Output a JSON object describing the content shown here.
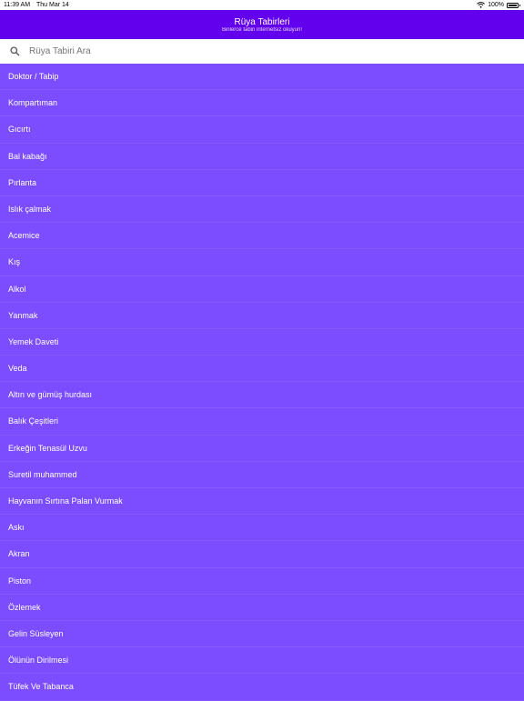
{
  "status_bar": {
    "time": "11:39 AM",
    "date": "Thu Mar 14",
    "battery": "100%"
  },
  "header": {
    "title": "Rüya Tabirleri",
    "subtitle": "Binlerce tabiri internetsiz okuyun!"
  },
  "search": {
    "placeholder": "Rüya Tabiri Ara"
  },
  "items": [
    "Doktor / Tabip",
    "Kompartıman",
    "Gıcırtı",
    "Bal kabağı",
    "Pırlanta",
    "Islık çalmak",
    "Acemice",
    "Kış",
    "Alkol",
    "Yanmak",
    "Yemek Daveti",
    "Veda",
    "Altın ve gümüş hurdası",
    "Balık Çeşitleri",
    "Erkeğin Tenasül Uzvu",
    "Suretil muhammed",
    "Hayvanın Sırtına Palan Vurmak",
    "Askı",
    "Akran",
    "Piston",
    "Özlemek",
    "Gelin Süsleyen",
    "Ölünün Dirilmesi",
    "Tüfek Ve Tabanca"
  ],
  "colors": {
    "app_bar": "#6200ee",
    "list_background": "#7c4dff",
    "search_background": "#ffffff"
  },
  "icons": {
    "search": "search-icon",
    "wifi": "wifi-icon",
    "battery": "battery-icon"
  }
}
